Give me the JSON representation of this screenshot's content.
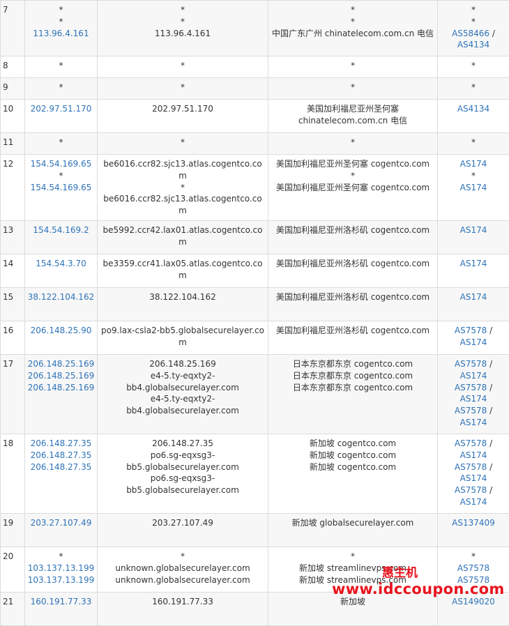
{
  "rows": [
    {
      "hop": "7",
      "ip": [
        "*",
        "*",
        "113.96.4.161"
      ],
      "host": [
        "*",
        "*",
        "113.96.4.161"
      ],
      "loc": [
        "*",
        "*",
        "中国广东广州 chinatelecom.com.cn 电信"
      ],
      "as": [
        [
          "*"
        ],
        [
          "*"
        ],
        [
          "AS58466",
          "AS4134"
        ]
      ],
      "h": 80
    },
    {
      "hop": "8",
      "ip": [
        "*"
      ],
      "host": [
        "*"
      ],
      "loc": [
        "*"
      ],
      "as": [
        [
          "*"
        ]
      ],
      "h": 31
    },
    {
      "hop": "9",
      "ip": [
        "*"
      ],
      "host": [
        "*"
      ],
      "loc": [
        "*"
      ],
      "as": [
        [
          "*"
        ]
      ],
      "h": 31
    },
    {
      "hop": "10",
      "ip": [
        "202.97.51.170"
      ],
      "host": [
        "202.97.51.170"
      ],
      "loc": [
        "美国加利福尼亚州圣何塞",
        "chinatelecom.com.cn 电信"
      ],
      "as": [
        [
          "AS4134"
        ]
      ],
      "h": 48
    },
    {
      "hop": "11",
      "ip": [
        "*"
      ],
      "host": [
        "*"
      ],
      "loc": [
        "*"
      ],
      "as": [
        [
          "*"
        ]
      ],
      "h": 31
    },
    {
      "hop": "12",
      "ip": [
        "154.54.169.65",
        "*",
        "154.54.169.65"
      ],
      "host": [
        "be6016.ccr82.sjc13.atlas.cogentco.com",
        "*",
        "be6016.ccr82.sjc13.atlas.cogentco.com"
      ],
      "loc": [
        "美国加利福尼亚州圣何塞 cogentco.com",
        "*",
        "美国加利福尼亚州圣何塞 cogentco.com"
      ],
      "as": [
        [
          "AS174"
        ],
        [
          "*"
        ],
        [
          "AS174"
        ]
      ],
      "h": 64
    },
    {
      "hop": "13",
      "ip": [
        "154.54.169.2"
      ],
      "host": [
        "be5992.ccr42.lax01.atlas.cogentco.com"
      ],
      "loc": [
        "美国加利福尼亚州洛杉矶 cogentco.com"
      ],
      "as": [
        [
          "AS174"
        ]
      ],
      "h": 48
    },
    {
      "hop": "14",
      "ip": [
        "154.54.3.70"
      ],
      "host": [
        "be3359.ccr41.lax05.atlas.cogentco.com"
      ],
      "loc": [
        "美国加利福尼亚州洛杉矶 cogentco.com"
      ],
      "as": [
        [
          "AS174"
        ]
      ],
      "h": 48
    },
    {
      "hop": "15",
      "ip": [
        "38.122.104.162"
      ],
      "host": [
        "38.122.104.162"
      ],
      "loc": [
        "美国加利福尼亚州洛杉矶 cogentco.com"
      ],
      "as": [
        [
          "AS174"
        ]
      ],
      "h": 48
    },
    {
      "hop": "16",
      "ip": [
        "206.148.25.90"
      ],
      "host": [
        "po9.lax-csla2-bb5.globalsecurelayer.com"
      ],
      "loc": [
        "美国加利福尼亚州洛杉矶 cogentco.com"
      ],
      "as": [
        [
          "AS7578",
          "AS174"
        ]
      ],
      "h": 48
    },
    {
      "hop": "17",
      "ip": [
        "206.148.25.169",
        "206.148.25.169",
        "206.148.25.169"
      ],
      "host": [
        "206.148.25.169",
        "e4-5.ty-eqxty2-",
        "bb4.globalsecurelayer.com",
        "e4-5.ty-eqxty2-",
        "bb4.globalsecurelayer.com"
      ],
      "loc": [
        "日本东京都东京 cogentco.com",
        "日本东京都东京 cogentco.com",
        "日本东京都东京 cogentco.com"
      ],
      "as": [
        [
          "AS7578",
          "AS174"
        ],
        [
          "AS7578",
          "AS174"
        ],
        [
          "AS7578",
          "AS174"
        ]
      ],
      "h": 114
    },
    {
      "hop": "18",
      "ip": [
        "206.148.27.35",
        "206.148.27.35",
        "206.148.27.35"
      ],
      "host": [
        "206.148.27.35",
        "po6.sg-eqxsg3-",
        "bb5.globalsecurelayer.com",
        "po6.sg-eqxsg3-",
        "bb5.globalsecurelayer.com"
      ],
      "loc": [
        "新加坡 cogentco.com",
        "新加坡 cogentco.com",
        "新加坡 cogentco.com"
      ],
      "as": [
        [
          "AS7578",
          "AS174"
        ],
        [
          "AS7578",
          "AS174"
        ],
        [
          "AS7578",
          "AS174"
        ]
      ],
      "h": 114
    },
    {
      "hop": "19",
      "ip": [
        "203.27.107.49"
      ],
      "host": [
        "203.27.107.49"
      ],
      "loc": [
        "新加坡 globalsecurelayer.com"
      ],
      "as": [
        [
          "AS137409"
        ]
      ],
      "h": 48
    },
    {
      "hop": "20",
      "ip": [
        "*",
        "103.137.13.199",
        "103.137.13.199"
      ],
      "host": [
        "*",
        "unknown.globalsecurelayer.com",
        "unknown.globalsecurelayer.com"
      ],
      "loc": [
        "*",
        "新加坡 streamlinevps.com",
        "新加坡 streamlinevps.com"
      ],
      "as": [
        [
          "*"
        ],
        [
          "AS7578"
        ],
        [
          "AS7578"
        ]
      ],
      "h": 65
    },
    {
      "hop": "21",
      "ip": [
        "160.191.77.33"
      ],
      "host": [
        "160.191.77.33"
      ],
      "loc": [
        "新加坡"
      ],
      "as": [
        [
          "AS149020"
        ]
      ],
      "h": 48
    }
  ],
  "watermark": {
    "title": "惠主机",
    "url": "www.idccoupon.com"
  },
  "colors": {
    "link": "#2e73b8",
    "border": "#dcdcdc",
    "stripe": "#f7f7f7",
    "watermark": "#e8141e"
  }
}
